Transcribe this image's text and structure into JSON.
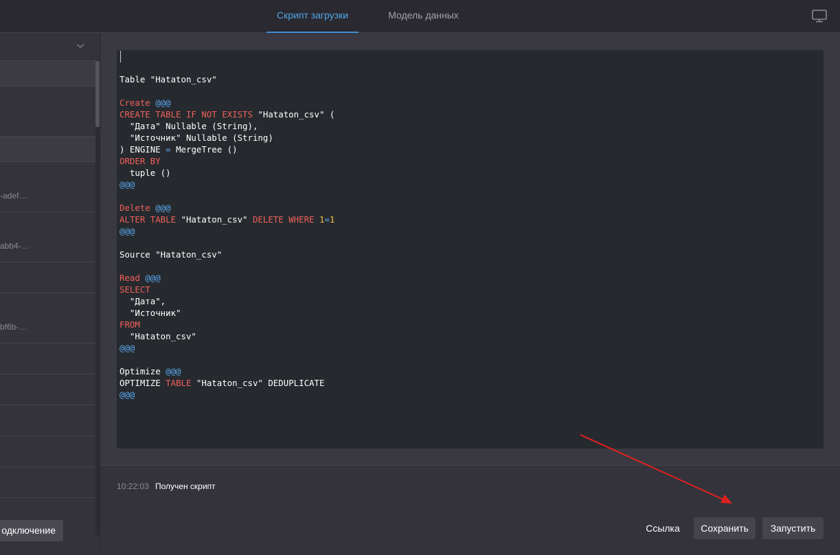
{
  "tabs": [
    {
      "label": "Скрипт загрузки",
      "active": true
    },
    {
      "label": "Модель данных",
      "active": false
    }
  ],
  "icons": {
    "monitor": "monitor-icon",
    "dropdown": "chevron-down-icon"
  },
  "sidebar": {
    "items": [
      {
        "text": ""
      },
      {
        "text": ""
      },
      {
        "text": ""
      },
      {
        "text": "-adef…"
      },
      {
        "text": "abb4-…"
      },
      {
        "text": ""
      },
      {
        "text": "bf6b-…"
      },
      {
        "text": ""
      },
      {
        "text": ""
      },
      {
        "text": ""
      },
      {
        "text": ""
      },
      {
        "text": ""
      }
    ],
    "connect_label": "одключение"
  },
  "editor": {
    "lines": [
      "Table \"Hataton_csv\"",
      "",
      "Create @@@",
      "CREATE TABLE IF NOT EXISTS \"Hataton_csv\" (",
      "  \"Дата\" Nullable (String),",
      "  \"Источник\" Nullable (String)",
      ") ENGINE = MergeTree ()",
      "ORDER BY",
      "  tuple ()",
      "@@@",
      "",
      "Delete @@@",
      "ALTER TABLE \"Hataton_csv\" DELETE WHERE 1=1",
      "@@@",
      "",
      "Source \"Hataton_csv\"",
      "",
      "Read @@@",
      "SELECT",
      "  \"Дата\",",
      "  \"Источник\"",
      "FROM",
      "  \"Hataton_csv\"",
      "@@@",
      "",
      "Optimize @@@",
      "OPTIMIZE TABLE \"Hataton_csv\" DEDUPLICATE",
      "@@@"
    ]
  },
  "log": {
    "time": "10:22:03",
    "message": "Получен скрипт"
  },
  "actions": {
    "link": "Ссылка",
    "save": "Сохранить",
    "run": "Запустить"
  },
  "colors": {
    "accent": "#4fa6e8",
    "keyword": "#f25f5c",
    "marker": "#5aa8f0",
    "number": "#f0c24a",
    "annotation_arrow": "#e0201e"
  }
}
